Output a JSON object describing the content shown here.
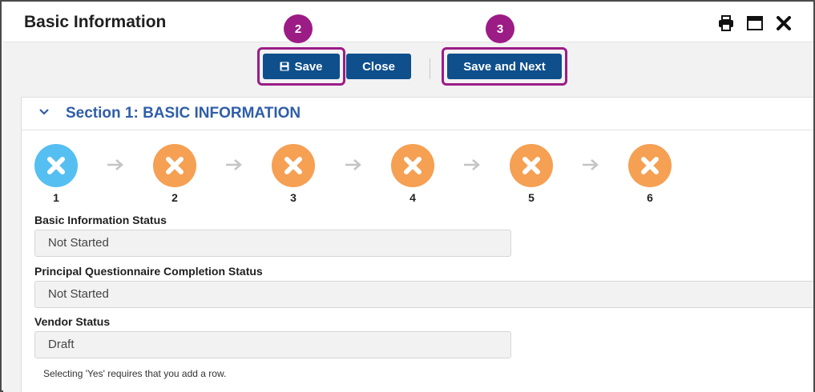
{
  "window": {
    "title": "Basic Information",
    "icons": [
      "print-icon",
      "maximize-icon",
      "close-icon"
    ]
  },
  "toolbar": {
    "save_label": "Save",
    "close_label": "Close",
    "save_next_label": "Save and Next",
    "callouts": [
      "2",
      "3"
    ]
  },
  "section": {
    "title": "Section 1: BASIC INFORMATION",
    "expanded": true
  },
  "steps": [
    {
      "number": "1",
      "state": "active"
    },
    {
      "number": "2",
      "state": "incomplete"
    },
    {
      "number": "3",
      "state": "incomplete"
    },
    {
      "number": "4",
      "state": "incomplete"
    },
    {
      "number": "5",
      "state": "incomplete"
    },
    {
      "number": "6",
      "state": "incomplete"
    }
  ],
  "fields": [
    {
      "label": "Basic Information Status",
      "value": "Not Started"
    },
    {
      "label": "Principal Questionnaire Completion Status",
      "value": "Not Started"
    },
    {
      "label": "Vendor Status",
      "value": "Draft"
    }
  ],
  "note": "Selecting 'Yes' requires that you add a row.",
  "colors": {
    "primary_button": "#0e4f8c",
    "callout": "#9c1c86",
    "section_title": "#2f5ea8",
    "step_active": "#56bff2",
    "step_incomplete": "#f5a053"
  }
}
